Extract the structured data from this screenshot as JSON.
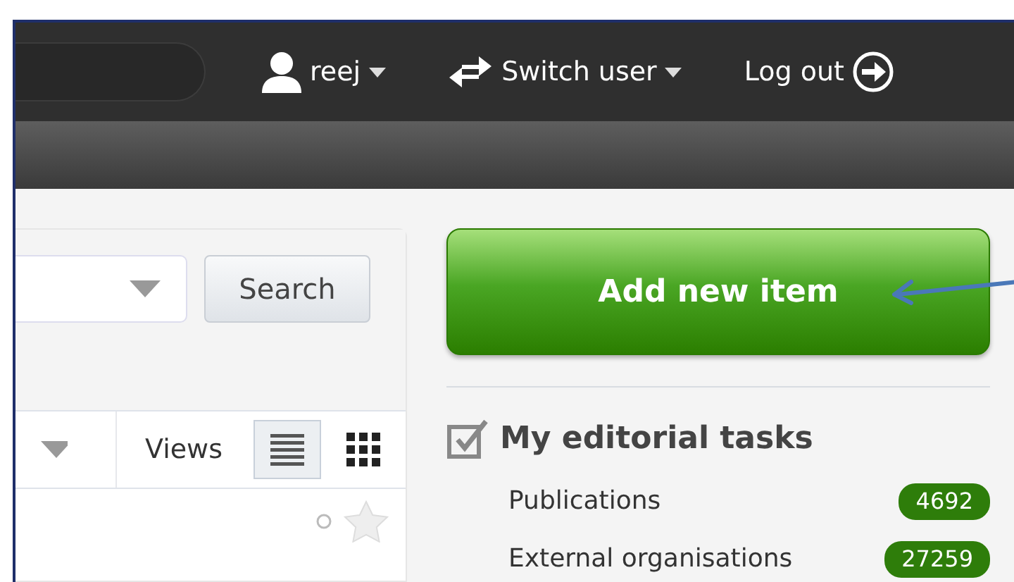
{
  "header": {
    "user": "reej",
    "switch_user": "Switch user",
    "logout": "Log out"
  },
  "search_panel": {
    "button": "Search"
  },
  "view_bar": {
    "label": "Views",
    "modes": [
      {
        "kind": "list",
        "selected": true
      },
      {
        "kind": "grid",
        "selected": false
      }
    ]
  },
  "sidebar": {
    "add_button": "Add new item",
    "tasks_title": "My editorial tasks",
    "tasks": [
      {
        "label": "Publications",
        "count": "4692"
      },
      {
        "label": "External organisations",
        "count": "27259"
      }
    ]
  }
}
